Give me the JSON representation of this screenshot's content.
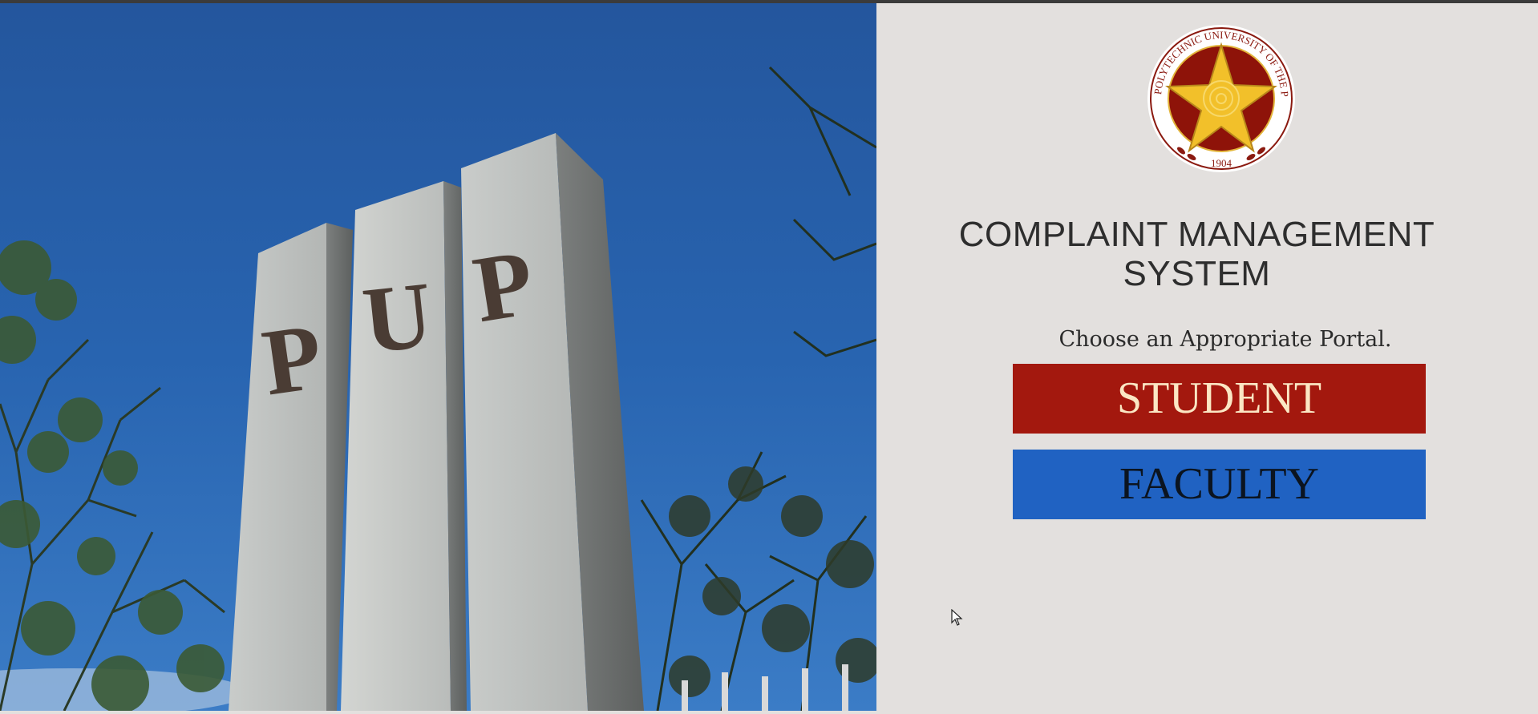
{
  "app": {
    "title": "COMPLAINT MANAGEMENT SYSTEM",
    "title_line1": "COMPLAINT MANAGEMENT",
    "title_line2": "SYSTEM"
  },
  "hero_image": {
    "description_icon": "pup-pylon-photo",
    "pylon_letters": [
      "P",
      "U",
      "P"
    ]
  },
  "logo": {
    "icon": "university-seal-icon",
    "ring_text": "POLYTECHNIC UNIVERSITY OF THE PHILIPPINES",
    "year": "1904"
  },
  "portal": {
    "prompt": "Choose an Appropriate Portal.",
    "student_label": "STUDENT",
    "faculty_label": "FACULTY"
  },
  "colors": {
    "student_bg": "#a3180e",
    "student_text": "#fbe7c4",
    "faculty_bg": "#2062c2",
    "faculty_text": "#0b1420",
    "panel_bg": "#e3e0de"
  }
}
